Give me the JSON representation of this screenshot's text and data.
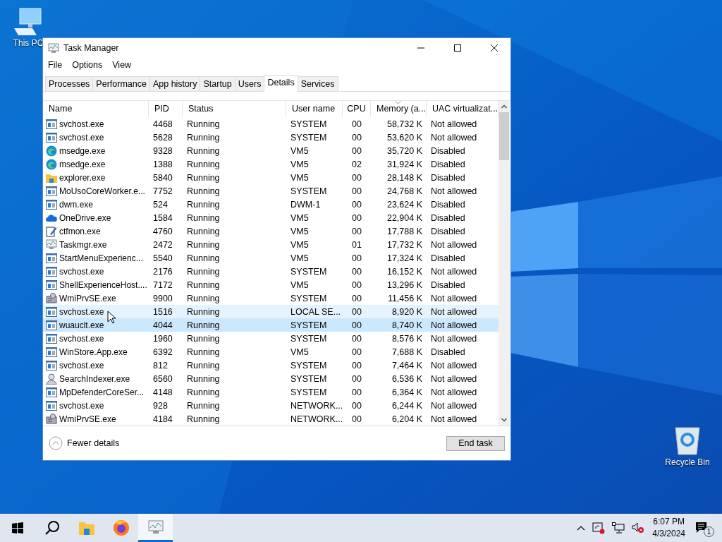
{
  "desktop_icons": [
    {
      "label": "This PC",
      "kind": "computer"
    },
    {
      "label": "Recycle Bin",
      "kind": "bin"
    }
  ],
  "window": {
    "title": "Task Manager"
  },
  "menu": [
    "File",
    "Options",
    "View"
  ],
  "tabs": [
    {
      "label": "Processes",
      "selected": false
    },
    {
      "label": "Performance",
      "selected": false
    },
    {
      "label": "App history",
      "selected": false
    },
    {
      "label": "Startup",
      "selected": false
    },
    {
      "label": "Users",
      "selected": false
    },
    {
      "label": "Details",
      "selected": true
    },
    {
      "label": "Services",
      "selected": false
    }
  ],
  "table": {
    "columns": [
      {
        "label": "Name",
        "sorted": false
      },
      {
        "label": "PID",
        "sorted": false
      },
      {
        "label": "Status",
        "sorted": false
      },
      {
        "label": "User name",
        "sorted": false
      },
      {
        "label": "CPU",
        "sorted": false
      },
      {
        "label": "Memory (a...",
        "sorted": true
      },
      {
        "label": "UAC virtualizat...",
        "sorted": false
      }
    ],
    "rows": [
      {
        "kind": "service",
        "name": "svchost.exe",
        "pid": "4468",
        "status": "Running",
        "user": "SYSTEM",
        "cpu": "00",
        "memory": "58,732 K",
        "uac": "Not allowed",
        "selected": false,
        "hovered": false
      },
      {
        "kind": "service",
        "name": "svchost.exe",
        "pid": "5628",
        "status": "Running",
        "user": "SYSTEM",
        "cpu": "00",
        "memory": "53,620 K",
        "uac": "Not allowed",
        "selected": false,
        "hovered": false
      },
      {
        "kind": "browser",
        "name": "msedge.exe",
        "pid": "9328",
        "status": "Running",
        "user": "VM5",
        "cpu": "00",
        "memory": "35,720 K",
        "uac": "Disabled",
        "selected": false,
        "hovered": false
      },
      {
        "kind": "browser",
        "name": "msedge.exe",
        "pid": "1388",
        "status": "Running",
        "user": "VM5",
        "cpu": "02",
        "memory": "31,924 K",
        "uac": "Disabled",
        "selected": false,
        "hovered": false
      },
      {
        "kind": "folder",
        "name": "explorer.exe",
        "pid": "5840",
        "status": "Running",
        "user": "VM5",
        "cpu": "00",
        "memory": "28,148 K",
        "uac": "Disabled",
        "selected": false,
        "hovered": false
      },
      {
        "kind": "service",
        "name": "MoUsoCoreWorker.e...",
        "pid": "7752",
        "status": "Running",
        "user": "SYSTEM",
        "cpu": "00",
        "memory": "24,768 K",
        "uac": "Not allowed",
        "selected": false,
        "hovered": false
      },
      {
        "kind": "service",
        "name": "dwm.exe",
        "pid": "524",
        "status": "Running",
        "user": "DWM-1",
        "cpu": "00",
        "memory": "23,624 K",
        "uac": "Disabled",
        "selected": false,
        "hovered": false
      },
      {
        "kind": "cloud",
        "name": "OneDrive.exe",
        "pid": "1584",
        "status": "Running",
        "user": "VM5",
        "cpu": "00",
        "memory": "22,904 K",
        "uac": "Disabled",
        "selected": false,
        "hovered": false
      },
      {
        "kind": "notepad",
        "name": "ctfmon.exe",
        "pid": "4760",
        "status": "Running",
        "user": "VM5",
        "cpu": "00",
        "memory": "17,788 K",
        "uac": "Disabled",
        "selected": false,
        "hovered": false
      },
      {
        "kind": "monitor",
        "name": "Taskmgr.exe",
        "pid": "2472",
        "status": "Running",
        "user": "VM5",
        "cpu": "01",
        "memory": "17,732 K",
        "uac": "Not allowed",
        "selected": false,
        "hovered": false
      },
      {
        "kind": "service",
        "name": "StartMenuExperienc...",
        "pid": "5540",
        "status": "Running",
        "user": "VM5",
        "cpu": "00",
        "memory": "17,324 K",
        "uac": "Disabled",
        "selected": false,
        "hovered": false
      },
      {
        "kind": "service",
        "name": "svchost.exe",
        "pid": "2176",
        "status": "Running",
        "user": "SYSTEM",
        "cpu": "00",
        "memory": "16,152 K",
        "uac": "Not allowed",
        "selected": false,
        "hovered": false
      },
      {
        "kind": "service",
        "name": "ShellExperienceHost....",
        "pid": "7172",
        "status": "Running",
        "user": "VM5",
        "cpu": "00",
        "memory": "13,296 K",
        "uac": "Disabled",
        "selected": false,
        "hovered": false
      },
      {
        "kind": "machine",
        "name": "WmiPrvSE.exe",
        "pid": "9900",
        "status": "Running",
        "user": "SYSTEM",
        "cpu": "00",
        "memory": "11,456 K",
        "uac": "Not allowed",
        "selected": false,
        "hovered": false
      },
      {
        "kind": "service",
        "name": "svchost.exe",
        "pid": "1516",
        "status": "Running",
        "user": "LOCAL SE...",
        "cpu": "00",
        "memory": "8,920 K",
        "uac": "Not allowed",
        "selected": false,
        "hovered": true
      },
      {
        "kind": "service",
        "name": "wuauclt.exe",
        "pid": "4044",
        "status": "Running",
        "user": "SYSTEM",
        "cpu": "00",
        "memory": "8,740 K",
        "uac": "Not allowed",
        "selected": true,
        "hovered": false
      },
      {
        "kind": "service",
        "name": "svchost.exe",
        "pid": "1960",
        "status": "Running",
        "user": "SYSTEM",
        "cpu": "00",
        "memory": "8,576 K",
        "uac": "Not allowed",
        "selected": false,
        "hovered": false
      },
      {
        "kind": "service",
        "name": "WinStore.App.exe",
        "pid": "6392",
        "status": "Running",
        "user": "VM5",
        "cpu": "00",
        "memory": "7,688 K",
        "uac": "Disabled",
        "selected": false,
        "hovered": false
      },
      {
        "kind": "service",
        "name": "svchost.exe",
        "pid": "812",
        "status": "Running",
        "user": "SYSTEM",
        "cpu": "00",
        "memory": "7,464 K",
        "uac": "Not allowed",
        "selected": false,
        "hovered": false
      },
      {
        "kind": "person",
        "name": "SearchIndexer.exe",
        "pid": "6560",
        "status": "Running",
        "user": "SYSTEM",
        "cpu": "00",
        "memory": "6,536 K",
        "uac": "Not allowed",
        "selected": false,
        "hovered": false
      },
      {
        "kind": "service",
        "name": "MpDefenderCoreSer...",
        "pid": "4148",
        "status": "Running",
        "user": "SYSTEM",
        "cpu": "00",
        "memory": "6,364 K",
        "uac": "Not allowed",
        "selected": false,
        "hovered": false
      },
      {
        "kind": "service",
        "name": "svchost.exe",
        "pid": "928",
        "status": "Running",
        "user": "NETWORK...",
        "cpu": "00",
        "memory": "6,244 K",
        "uac": "Not allowed",
        "selected": false,
        "hovered": false
      },
      {
        "kind": "machine",
        "name": "WmiPrvSE.exe",
        "pid": "4184",
        "status": "Running",
        "user": "NETWORK...",
        "cpu": "00",
        "memory": "6,204 K",
        "uac": "Not allowed",
        "selected": false,
        "hovered": false
      }
    ]
  },
  "footer": {
    "toggle": "Fewer details",
    "button": "End task"
  },
  "taskbar": {
    "apps": [
      {
        "kind": "start",
        "active": false
      },
      {
        "kind": "search",
        "active": false
      },
      {
        "kind": "folder",
        "active": false
      },
      {
        "kind": "browser",
        "active": false
      },
      {
        "kind": "monitor",
        "active": true
      }
    ],
    "time": "6:07 PM",
    "date": "4/3/2024",
    "notifications": "1"
  }
}
